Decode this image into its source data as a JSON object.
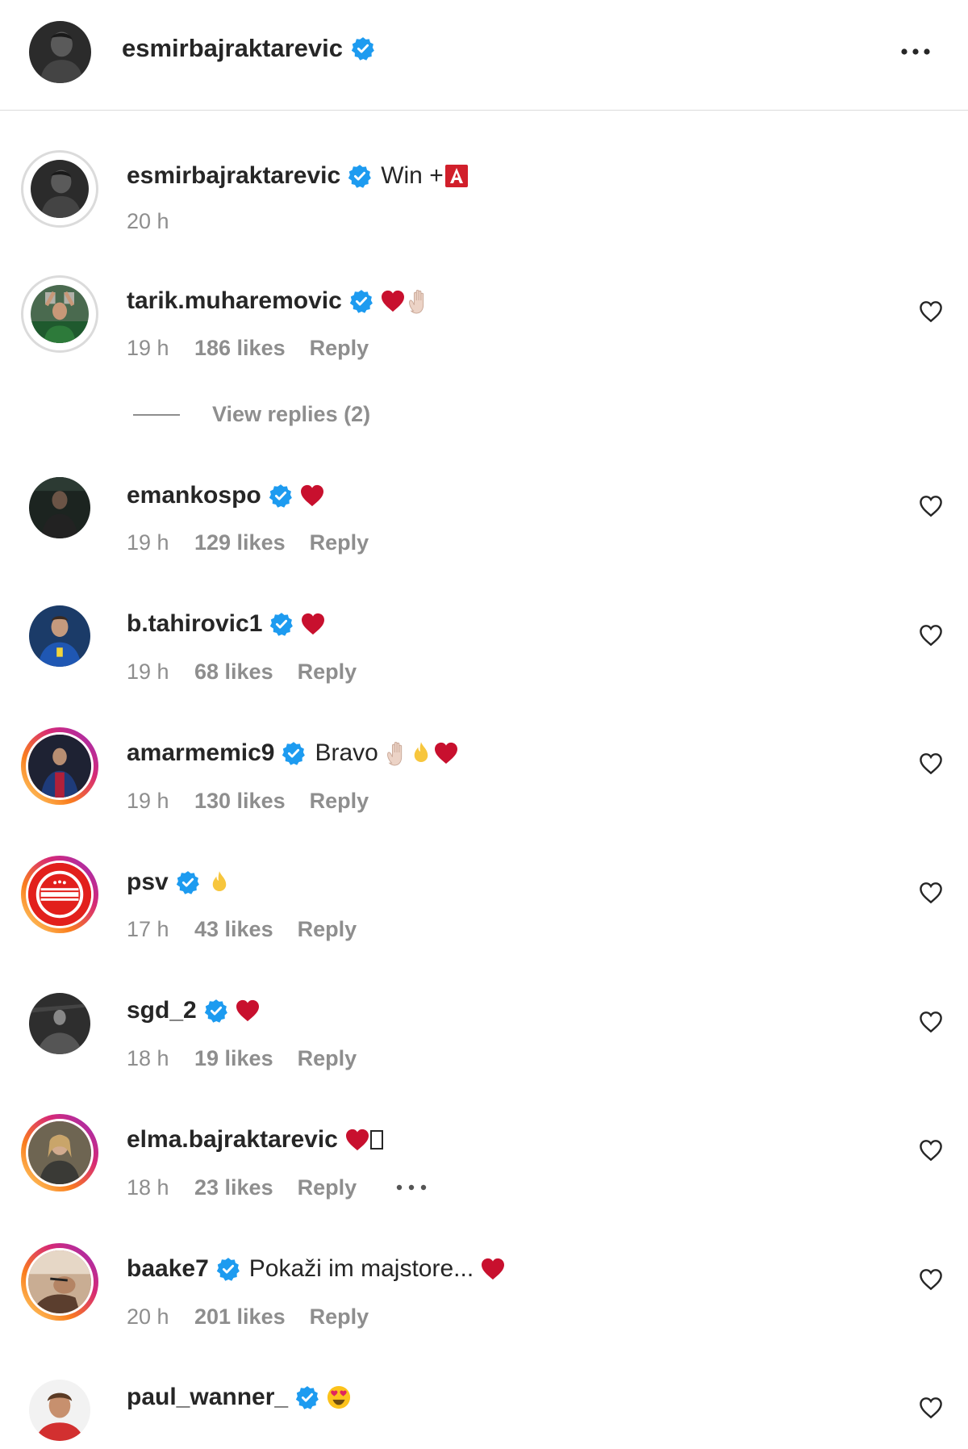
{
  "header": {
    "username": "esmirbajraktarevic",
    "more_label": "More options"
  },
  "caption": {
    "username": "esmirbajraktarevic",
    "text": "Win +",
    "time": "20 h"
  },
  "view_replies_label": "View replies (2)",
  "comments": [
    {
      "username": "tarik.muharemovic",
      "text": "",
      "emojis": [
        "red-heart",
        "waving-hand"
      ],
      "time": "19 h",
      "likes": "186 likes",
      "reply": "Reply"
    },
    {
      "username": "emankospo",
      "text": "",
      "emojis": [
        "red-heart"
      ],
      "time": "19 h",
      "likes": "129 likes",
      "reply": "Reply"
    },
    {
      "username": "b.tahirovic1",
      "text": "",
      "emojis": [
        "red-heart"
      ],
      "time": "19 h",
      "likes": "68 likes",
      "reply": "Reply"
    },
    {
      "username": "amarmemic9",
      "text": "Bravo",
      "emojis": [
        "waving-hand",
        "fire",
        "red-heart"
      ],
      "time": "19 h",
      "likes": "130 likes",
      "reply": "Reply"
    },
    {
      "username": "psv",
      "text": "",
      "emojis": [
        "fire"
      ],
      "time": "17 h",
      "likes": "43 likes",
      "reply": "Reply"
    },
    {
      "username": "sgd_2",
      "text": "",
      "emojis": [
        "red-heart"
      ],
      "time": "18 h",
      "likes": "19 likes",
      "reply": "Reply"
    },
    {
      "username": "elma.bajraktarevic",
      "text": "",
      "emojis": [
        "red-heart",
        "unknown-glyph"
      ],
      "time": "18 h",
      "likes": "23 likes",
      "reply": "Reply"
    },
    {
      "username": "baake7",
      "text": "Pokaži im majstore...",
      "emojis": [
        "red-heart"
      ],
      "time": "20 h",
      "likes": "201 likes",
      "reply": "Reply"
    },
    {
      "username": "paul_wanner_",
      "text": "",
      "emojis": [
        "heart-eyes"
      ],
      "time": "",
      "likes": "",
      "reply": ""
    }
  ],
  "colors": {
    "verified": "#1d9bf0",
    "heart": "#c8102e",
    "secondary_text": "#8e8e8e",
    "divider": "#dbdbdb"
  }
}
